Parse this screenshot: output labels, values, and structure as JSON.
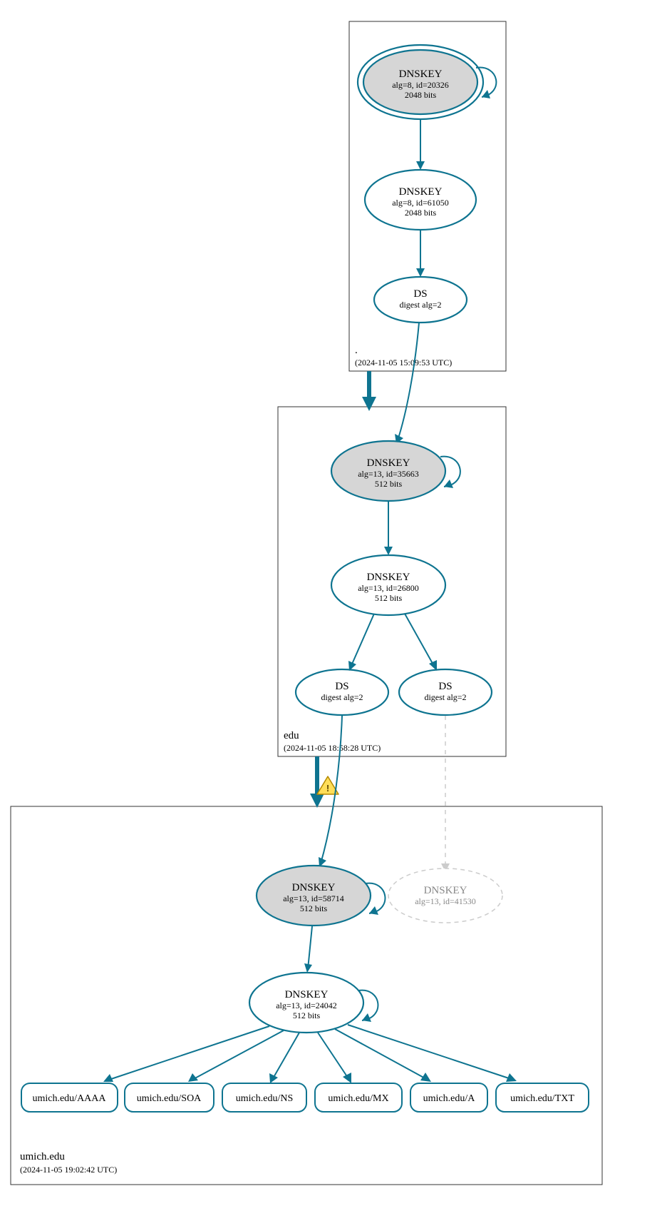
{
  "colors": {
    "stroke": "#0e7490",
    "node_fill_grey": "#d6d6d6",
    "ghost": "#cccccc",
    "box_stroke": "#333333"
  },
  "zones": {
    "root": {
      "label": ".",
      "timestamp": "(2024-11-05 15:09:53 UTC)"
    },
    "edu": {
      "label": "edu",
      "timestamp": "(2024-11-05 18:58:28 UTC)"
    },
    "umich": {
      "label": "umich.edu",
      "timestamp": "(2024-11-05 19:02:42 UTC)"
    }
  },
  "nodes": {
    "root_ksk": {
      "title": "DNSKEY",
      "line2": "alg=8, id=20326",
      "line3": "2048 bits"
    },
    "root_zsk": {
      "title": "DNSKEY",
      "line2": "alg=8, id=61050",
      "line3": "2048 bits"
    },
    "root_ds": {
      "title": "DS",
      "line2": "digest alg=2"
    },
    "edu_ksk": {
      "title": "DNSKEY",
      "line2": "alg=13, id=35663",
      "line3": "512 bits"
    },
    "edu_zsk": {
      "title": "DNSKEY",
      "line2": "alg=13, id=26800",
      "line3": "512 bits"
    },
    "edu_ds1": {
      "title": "DS",
      "line2": "digest alg=2"
    },
    "edu_ds2": {
      "title": "DS",
      "line2": "digest alg=2"
    },
    "umich_ksk": {
      "title": "DNSKEY",
      "line2": "alg=13, id=58714",
      "line3": "512 bits"
    },
    "umich_ghost": {
      "title": "DNSKEY",
      "line2": "alg=13, id=41530"
    },
    "umich_zsk": {
      "title": "DNSKEY",
      "line2": "alg=13, id=24042",
      "line3": "512 bits"
    }
  },
  "records": {
    "aaaa": "umich.edu/AAAA",
    "soa": "umich.edu/SOA",
    "ns": "umich.edu/NS",
    "mx": "umich.edu/MX",
    "a": "umich.edu/A",
    "txt": "umich.edu/TXT"
  },
  "warning_icon": "⚠"
}
